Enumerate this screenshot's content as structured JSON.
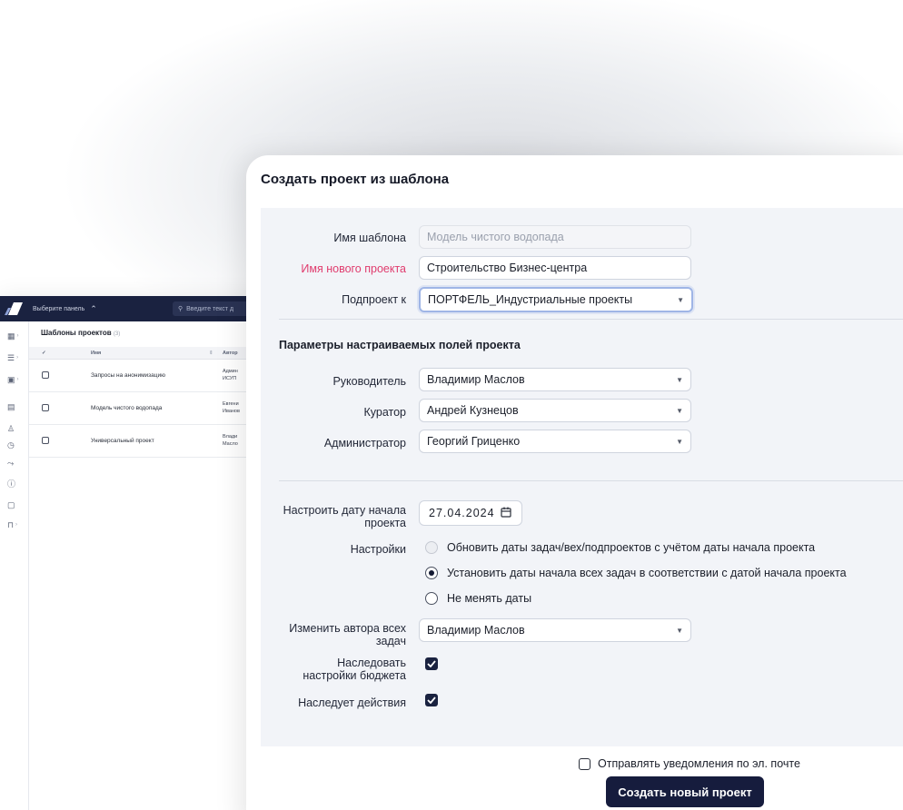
{
  "background_app": {
    "panel_select": "Выберите панель",
    "search_placeholder": "Введите текст д",
    "list_title": "Шаблоны проектов",
    "list_count": "(3)",
    "table_headers": {
      "check": "✓",
      "name": "Имя",
      "author": "Автор"
    },
    "rows": [
      {
        "name": "Запросы на анонимизацию",
        "author_line1": "Админ",
        "author_line2": "ИСУП"
      },
      {
        "name": "Модель чистого водопада",
        "author_line1": "Евгени",
        "author_line2": "Иванов"
      },
      {
        "name": "Универсальный проект",
        "author_line1": "Влади",
        "author_line2": "Масло"
      }
    ]
  },
  "modal": {
    "title": "Создать проект из шаблона",
    "template_name_label": "Имя шаблона",
    "template_name_value": "Модель чистого водопада",
    "new_project_label": "Имя нового проекта",
    "new_project_value": "Строительство Бизнес-центра",
    "subproject_label": "Подпроект к",
    "subproject_value": "ПОРТФЕЛЬ_Индустриальные проекты",
    "custom_fields_title": "Параметры настраиваемых полей проекта",
    "manager_label": "Руководитель",
    "manager_value": "Владимир Маслов",
    "curator_label": "Куратор",
    "curator_value": "Андрей Кузнецов",
    "admin_label": "Администратор",
    "admin_value": "Георгий Гриценко",
    "start_date_label_1": "Настроить дату начала",
    "start_date_label_2": "проекта",
    "start_date_value": "27.04.2024",
    "settings_label": "Настройки",
    "settings_options": [
      "Обновить даты задач/вех/подпроектов с учётом даты начала проекта",
      "Установить даты начала всех задач в соответствии с датой начала проекта",
      "Не менять даты"
    ],
    "settings_selected": 1,
    "author_label_1": "Изменить автора всех",
    "author_label_2": "задач",
    "author_value": "Владимир Маслов",
    "budget_label_1": "Наследовать",
    "budget_label_2": "настройки бюджета",
    "budget_checked": true,
    "actions_label": "Наследует действия",
    "actions_checked": true,
    "email_label": "Отправлять уведомления по эл. почте",
    "email_checked": false,
    "submit_label": "Создать новый проект"
  },
  "colors": {
    "accent_dark": "#161c3d",
    "required_label": "#e03c6e",
    "focus_border": "#9fb5e6"
  }
}
